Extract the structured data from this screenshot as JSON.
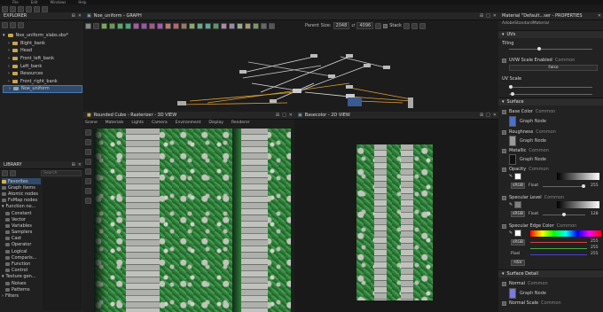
{
  "menubar": {
    "items": [
      "File",
      "Edit",
      "Windows",
      "Help"
    ]
  },
  "explorer": {
    "title": "EXPLORER",
    "root": "Noe_uniform_slabs.sbs*",
    "items": [
      "Bight_bank",
      "Head",
      "Front_left_bank",
      "Left_bank",
      "Resources",
      "Front_right_bank",
      "Noe_uniform"
    ]
  },
  "library": {
    "title": "LIBRARY",
    "search_placeholder": "Search",
    "items": [
      "Favorites",
      "Graph items",
      "Atomic nodes",
      "FxMap nodes",
      "Function no...",
      "Constant",
      "Vector",
      "Variables",
      "Samplers",
      "Cast",
      "Operator",
      "Logical",
      "Comparis...",
      "Function",
      "Control",
      "Texture gen...",
      "Noises",
      "Patterns",
      "Filters"
    ]
  },
  "graph": {
    "title": "Noe_uniform - GRAPH",
    "parent_size_label": "Parent Size:",
    "parent_size_value": "2048",
    "size_value": "4096",
    "stack_label": "Stack"
  },
  "view3d": {
    "title": "Rounded Cube - Rasterizer - 3D VIEW",
    "menu": [
      "Scene",
      "Materials",
      "Lights",
      "Camera",
      "Environment",
      "Display",
      "Renderer"
    ]
  },
  "view2d": {
    "title": "Basecolor - 2D VIEW"
  },
  "properties": {
    "title": "Material \"Default...ser - PROPERTIES",
    "subtitle": "AdobeStandardMaterial",
    "uvs_section": "UVs",
    "tiling_label": "Tiling",
    "uvw_scale_label": "UVW Scale Enabled",
    "uvw_scale_tag": "Common",
    "uvw_value": "False",
    "uv_scale_label": "UV Scale",
    "surface_section": "Surface",
    "base_color_label": "Base Color",
    "base_color_tag": "Common",
    "graph_node": "Graph Node",
    "roughness_label": "Roughness",
    "roughness_tag": "Common",
    "metallic_label": "Metallic",
    "metallic_tag": "Common",
    "opacity_label": "Opacity",
    "opacity_tag": "Common",
    "srgb": "sRGB",
    "float": "Float",
    "opacity_value": "255",
    "specular_level_label": "Specular Level",
    "specular_level_tag": "Common",
    "specular_value": "128",
    "specular_edge_label": "Specular Edge Color",
    "specular_edge_tag": "Common",
    "edge_vals": [
      "255",
      "255",
      "255"
    ],
    "pixel": "Pixel",
    "hsv": "HSV",
    "surface_detail_section": "Surface Detail",
    "normal_label": "Normal",
    "normal_tag": "Common",
    "normal_scale_label": "Normal Scale",
    "normal_scale_tag": "Common",
    "accent": "#3d7fd6"
  }
}
